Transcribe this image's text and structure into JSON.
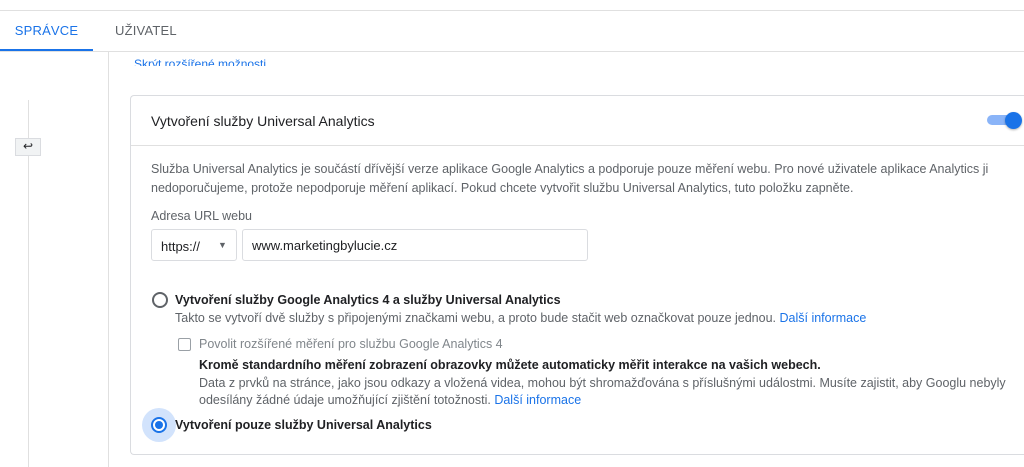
{
  "tabs": [
    {
      "label": "SPRÁVCE",
      "active": true
    },
    {
      "label": "UŽIVATEL",
      "active": false
    }
  ],
  "collapse_icon": "arrow-left-bar-icon",
  "hide_options_link": "Skrýt rozšířené možnosti",
  "card": {
    "title": "Vytvoření služby Universal Analytics",
    "toggle_on": true,
    "description": "Služba Universal Analytics je součástí dřívější verze aplikace Google Analytics a podporuje pouze měření webu. Pro nové uživatele aplikace Analytics ji nedoporučujeme, protože nepodporuje měření aplikací. Pokud chcete vytvořit službu Universal Analytics, tuto položku zapněte.",
    "url_label": "Adresa URL webu",
    "protocol": "https://",
    "url_value": "www.marketingbylucie.cz",
    "option1": {
      "title": "Vytvoření služby Google Analytics 4 a služby Universal Analytics",
      "subtitle": "Takto se vytvoří dvě služby s připojenými značkami webu, a proto bude stačit web označkovat pouze jednou.",
      "link": "Další informace",
      "selected": false
    },
    "enhanced": {
      "checkbox_label": "Povolit rozšířené měření pro službu Google Analytics 4",
      "checked": false,
      "bold_text": "Kromě standardního měření zobrazení obrazovky můžete automaticky měřit interakce na vašich webech.",
      "text": "Data z prvků na stránce, jako jsou odkazy a vložená videa, mohou být shromažďována s příslušnými událostmi. Musíte zajistit, aby Googlu nebyly odesílány žádné údaje umožňující zjištění totožnosti.",
      "link": "Další informace"
    },
    "option2": {
      "title": "Vytvoření pouze služby Universal Analytics",
      "selected": true
    }
  },
  "colors": {
    "accent": "#1a73e8",
    "text": "#202124",
    "muted": "#5f6368"
  }
}
